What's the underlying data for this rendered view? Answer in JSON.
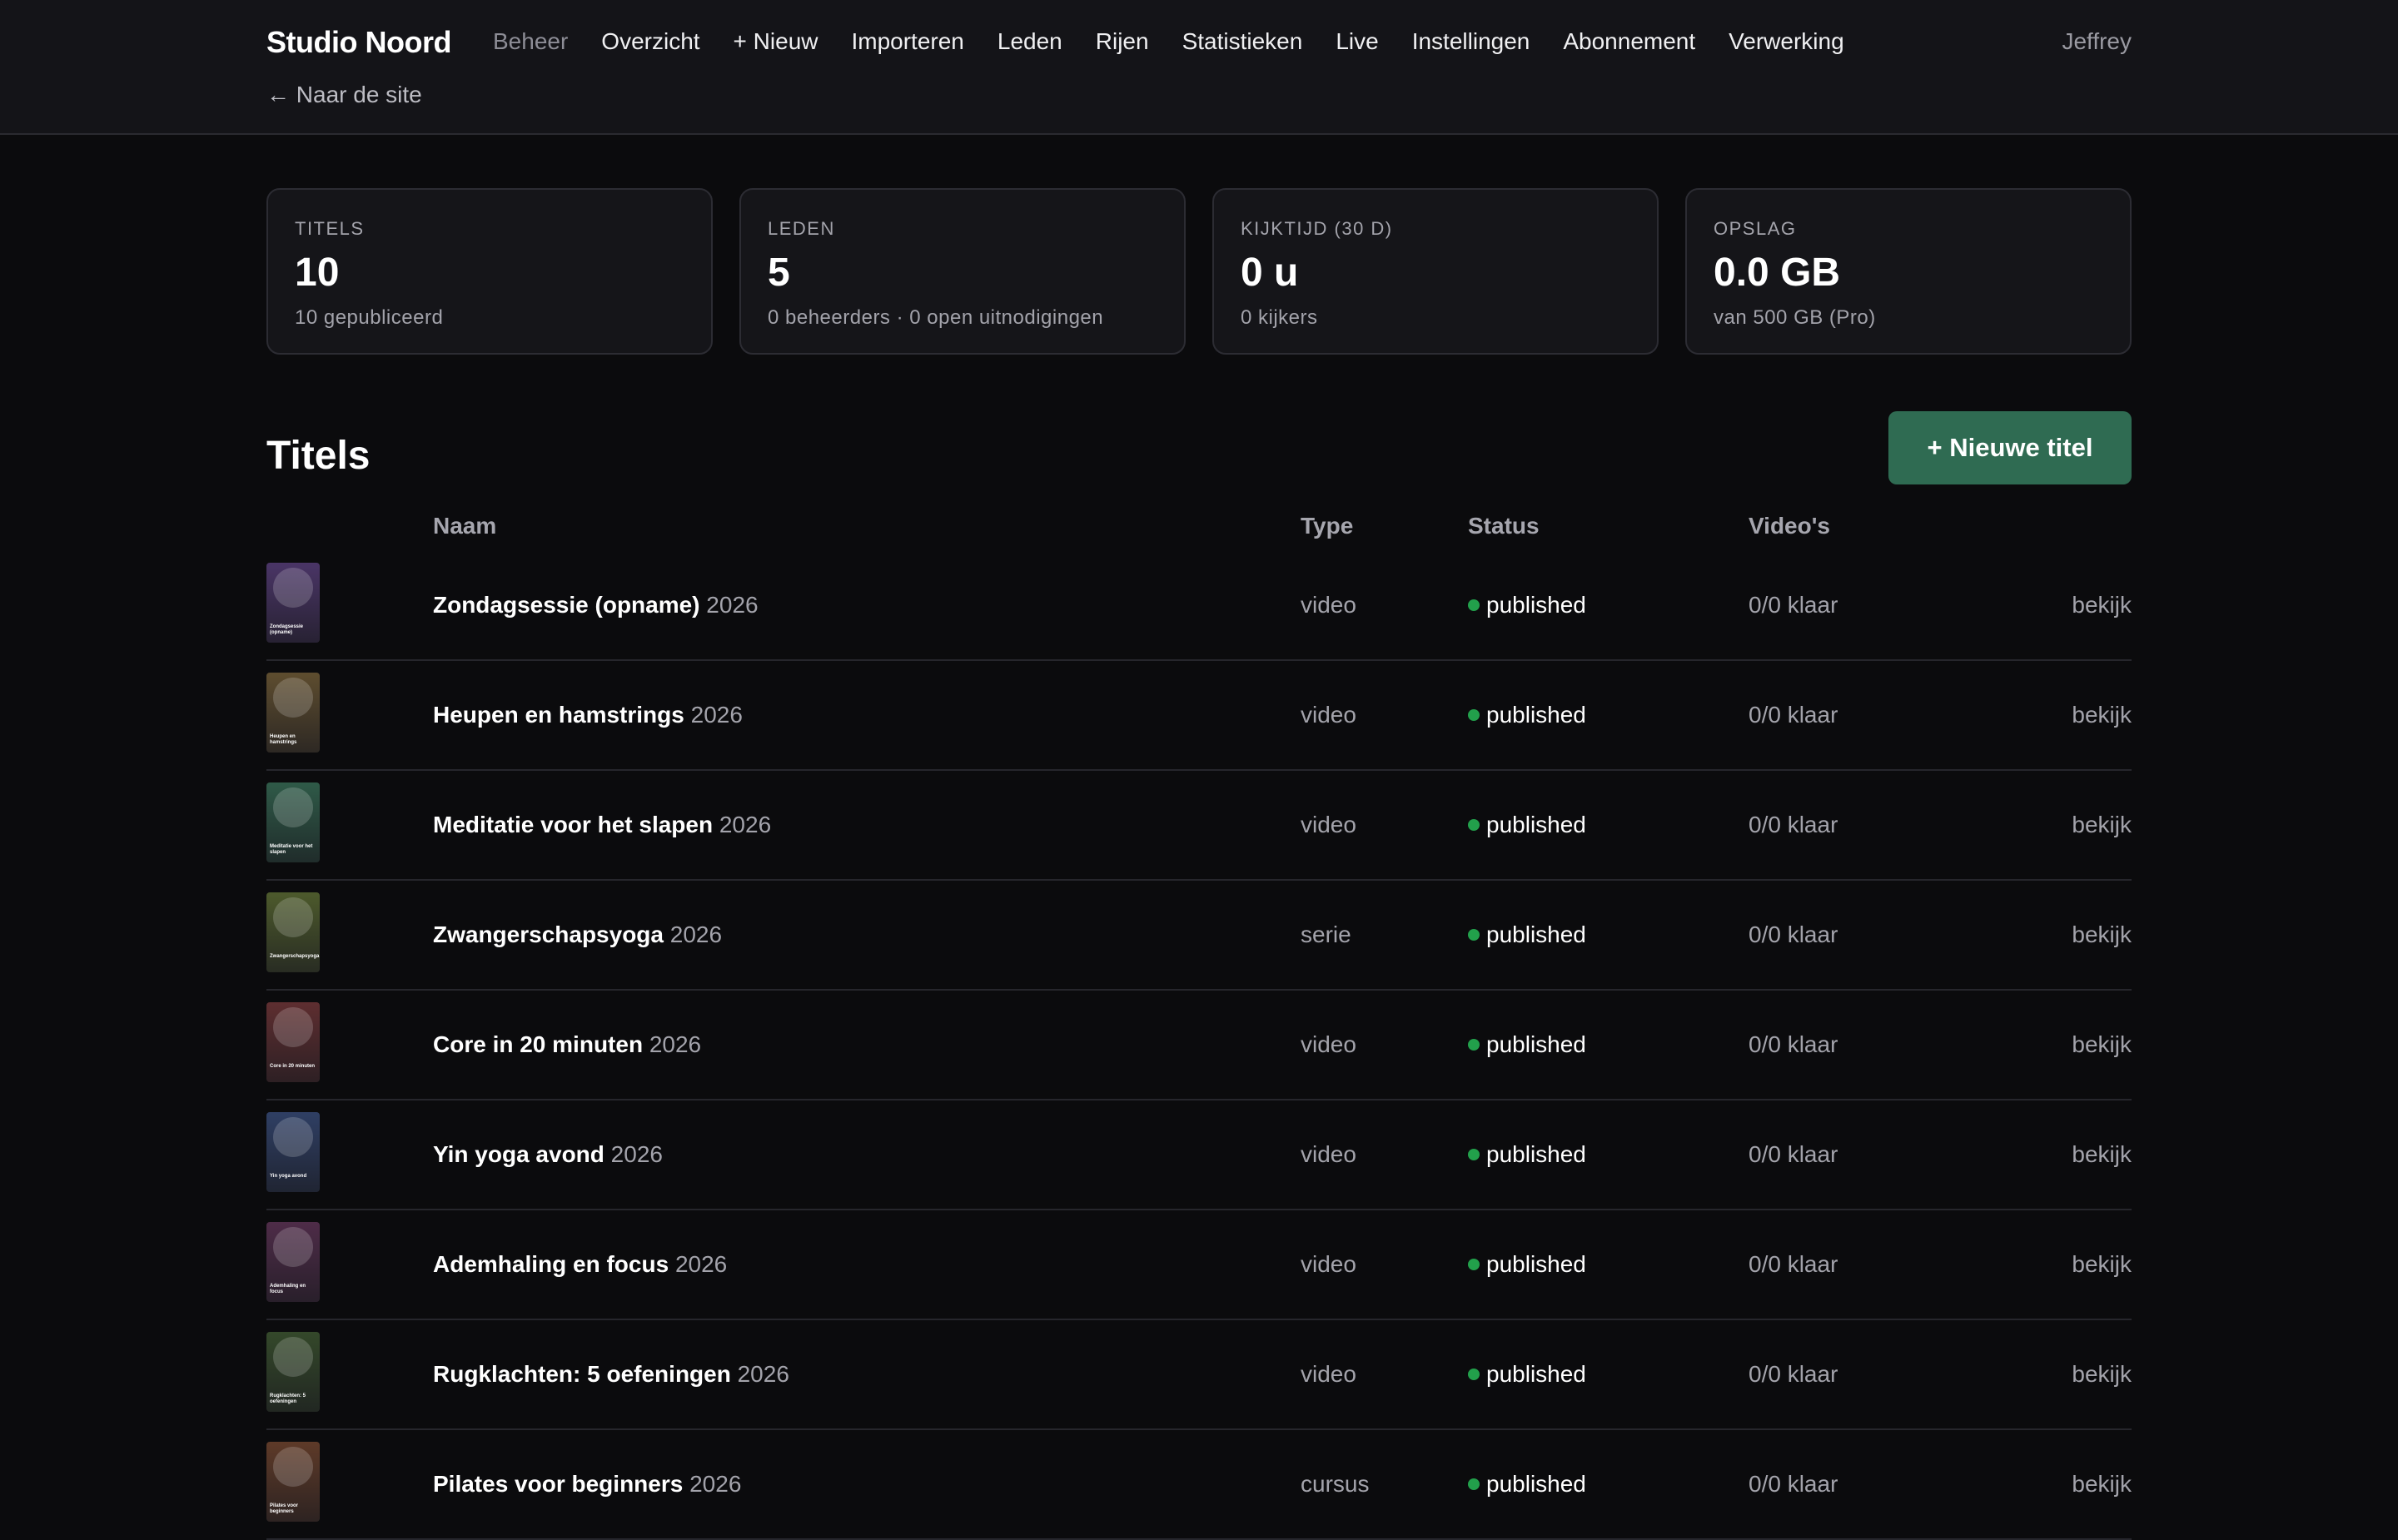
{
  "brand": "Studio Noord",
  "nav": [
    "Beheer",
    "Overzicht",
    "+ Nieuw",
    "Importeren",
    "Leden",
    "Rijen",
    "Statistieken",
    "Live",
    "Instellingen",
    "Abonnement",
    "Verwerking"
  ],
  "user": "Jeffrey",
  "back_link": "← Naar de site",
  "stats": [
    {
      "label": "TITELS",
      "value": "10",
      "sub": "10 gepubliceerd"
    },
    {
      "label": "LEDEN",
      "value": "5",
      "sub": "0 beheerders · 0 open uitnodigingen"
    },
    {
      "label": "KIJKTIJD (30 D)",
      "value": "0 u",
      "sub": "0 kijkers"
    },
    {
      "label": "OPSLAG",
      "value": "0.0 GB",
      "sub": "van 500 GB (Pro)"
    }
  ],
  "section_title": "Titels",
  "new_title_button": "+ Nieuwe titel",
  "columns": {
    "name": "Naam",
    "type": "Type",
    "status": "Status",
    "videos": "Video's"
  },
  "rows": [
    {
      "name": "Zondagsessie (opname)",
      "year": "2026",
      "type": "video",
      "status": "published",
      "videos": "0/0 klaar",
      "action": "bekijk",
      "thumb_color": "#4a3566"
    },
    {
      "name": "Heupen en hamstrings",
      "year": "2026",
      "type": "video",
      "status": "published",
      "videos": "0/0 klaar",
      "action": "bekijk",
      "thumb_color": "#5e4d2f"
    },
    {
      "name": "Meditatie voor het slapen",
      "year": "2026",
      "type": "video",
      "status": "published",
      "videos": "0/0 klaar",
      "action": "bekijk",
      "thumb_color": "#2f5a48"
    },
    {
      "name": "Zwangerschapsyoga",
      "year": "2026",
      "type": "serie",
      "status": "published",
      "videos": "0/0 klaar",
      "action": "bekijk",
      "thumb_color": "#4d5a2c"
    },
    {
      "name": "Core in 20 minuten",
      "year": "2026",
      "type": "video",
      "status": "published",
      "videos": "0/0 klaar",
      "action": "bekijk",
      "thumb_color": "#5e2e30"
    },
    {
      "name": "Yin yoga avond",
      "year": "2026",
      "type": "video",
      "status": "published",
      "videos": "0/0 klaar",
      "action": "bekijk",
      "thumb_color": "#2f3f64"
    },
    {
      "name": "Ademhaling en focus",
      "year": "2026",
      "type": "video",
      "status": "published",
      "videos": "0/0 klaar",
      "action": "bekijk",
      "thumb_color": "#4e2c48"
    },
    {
      "name": "Rugklachten: 5 oefeningen",
      "year": "2026",
      "type": "video",
      "status": "published",
      "videos": "0/0 klaar",
      "action": "bekijk",
      "thumb_color": "#34482a"
    },
    {
      "name": "Pilates voor beginners",
      "year": "2026",
      "type": "cursus",
      "status": "published",
      "videos": "0/0 klaar",
      "action": "bekijk",
      "thumb_color": "#5e3a28"
    }
  ],
  "colors": {
    "accent": "#2f6b52",
    "status_published": "#22a04b"
  }
}
